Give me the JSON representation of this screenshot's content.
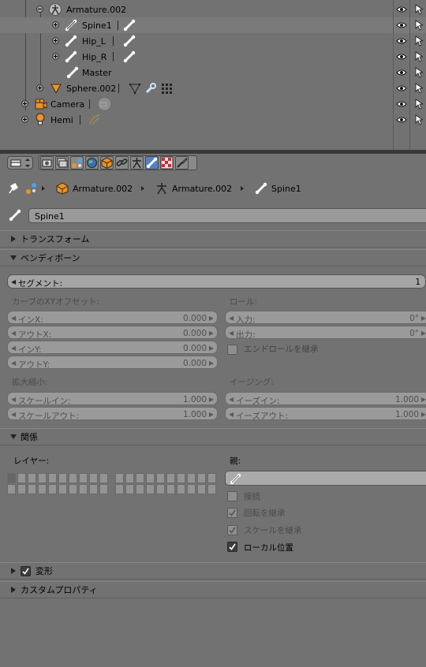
{
  "outliner": {
    "items": [
      {
        "name": "Armature.002"
      },
      {
        "name": "Spine1"
      },
      {
        "name": "Hip_L"
      },
      {
        "name": "Hip_R"
      },
      {
        "name": "Master"
      },
      {
        "name": "Sphere.002"
      },
      {
        "name": "Camera"
      },
      {
        "name": "Hemi"
      }
    ]
  },
  "properties": {
    "breadcrumb": [
      "Armature.002",
      "Armature.002",
      "Spine1"
    ],
    "bone_name": "Spine1",
    "panels": {
      "transform": "トランスフォーム",
      "bendy": "ベンディボーン",
      "relations": "関係",
      "deform": "変形",
      "custom": "カスタムプロパティ"
    },
    "segments": {
      "label": "セグメント:",
      "value": "1"
    },
    "curve": {
      "title": "カーブのXYオフセット:",
      "fields": [
        {
          "label": "インX:",
          "value": "0.000"
        },
        {
          "label": "アウトX:",
          "value": "0.000"
        },
        {
          "label": "インY:",
          "value": "0.000"
        },
        {
          "label": "アウトY:",
          "value": "0.000"
        }
      ]
    },
    "roll": {
      "title": "ロール:",
      "fields": [
        {
          "label": "入力:",
          "value": "0°"
        },
        {
          "label": "出力:",
          "value": "0°"
        }
      ],
      "inherit_end": "エンドロールを継承"
    },
    "scale": {
      "title": "拡大縮小:",
      "fields": [
        {
          "label": "スケールイン:",
          "value": "1.000"
        },
        {
          "label": "スケールアウト:",
          "value": "1.000"
        }
      ]
    },
    "easing": {
      "title": "イージング:",
      "fields": [
        {
          "label": "イーズイン:",
          "value": "1.000"
        },
        {
          "label": "イーズアウト:",
          "value": "1.000"
        }
      ]
    },
    "relations": {
      "layers_label": "レイヤー:",
      "parent_label": "親:",
      "connected": "接続",
      "inherit_rotation": "回転を継承",
      "inherit_scale": "スケールを継承",
      "local_location": "ローカル位置"
    }
  }
}
